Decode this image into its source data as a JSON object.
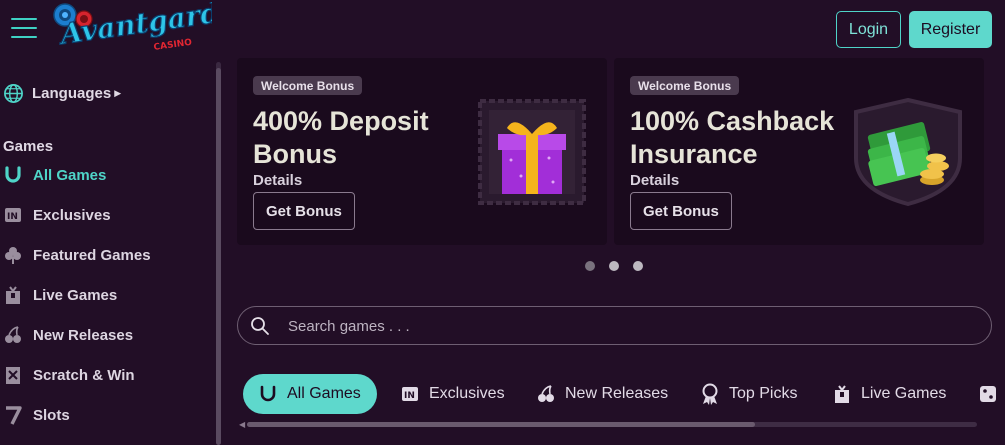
{
  "header": {
    "brand": "Avantgarde",
    "brand_sub": "CASINO",
    "login_label": "Login",
    "register_label": "Register"
  },
  "sidebar": {
    "languages_label": "Languages",
    "section_label": "Games",
    "items": [
      {
        "label": "All Games",
        "icon": "horseshoe-icon",
        "active": true
      },
      {
        "label": "Exclusives",
        "icon": "exclusive-badge-icon"
      },
      {
        "label": "Featured Games",
        "icon": "clover-icon"
      },
      {
        "label": "Live Games",
        "icon": "dealer-icon"
      },
      {
        "label": "New Releases",
        "icon": "cherries-icon"
      },
      {
        "label": "Scratch & Win",
        "icon": "scratch-card-icon"
      },
      {
        "label": "Slots",
        "icon": "seven-icon"
      }
    ]
  },
  "promos": [
    {
      "badge": "Welcome Bonus",
      "title": "400% Deposit Bonus",
      "details": "Details",
      "button": "Get Bonus",
      "art": "gift-box-icon"
    },
    {
      "badge": "Welcome Bonus",
      "title": "100% Cashback Insurance",
      "details": "Details",
      "button": "Get Bonus",
      "art": "cash-coins-icon"
    }
  ],
  "carousel": {
    "dots": 3,
    "active_index": 0
  },
  "search": {
    "placeholder": "Search games . . ."
  },
  "tabs": [
    {
      "label": "All Games",
      "icon": "horseshoe-icon",
      "active": true
    },
    {
      "label": "Exclusives",
      "icon": "exclusive-badge-icon"
    },
    {
      "label": "New Releases",
      "icon": "cherries-icon"
    },
    {
      "label": "Top Picks",
      "icon": "award-ribbon-icon"
    },
    {
      "label": "Live Games",
      "icon": "dealer-icon"
    }
  ],
  "colors": {
    "background": "#220e26",
    "accent": "#5ed8cc",
    "card": "#1a0a1d"
  }
}
